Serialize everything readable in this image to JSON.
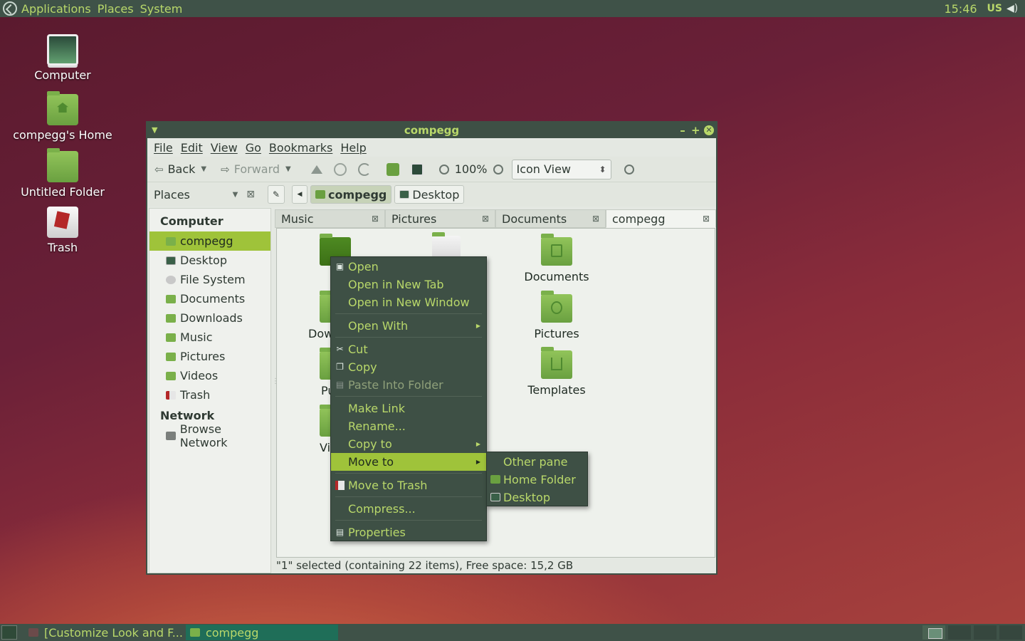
{
  "top_panel": {
    "menus": [
      "Applications",
      "Places",
      "System"
    ],
    "clock": "15:46",
    "keyboard": "US"
  },
  "desktop_icons": [
    {
      "label": "Computer",
      "icon": "computer-icon"
    },
    {
      "label": "compegg's Home",
      "icon": "home-folder-icon"
    },
    {
      "label": "Untitled Folder",
      "icon": "folder-icon"
    },
    {
      "label": "Trash",
      "icon": "trash-icon"
    }
  ],
  "window": {
    "title": "compegg",
    "menubar": [
      "File",
      "Edit",
      "View",
      "Go",
      "Bookmarks",
      "Help"
    ],
    "toolbar": {
      "back": "Back",
      "forward": "Forward",
      "zoom": "100%",
      "view_mode": "Icon View"
    },
    "location": {
      "places_label": "Places",
      "crumbs": [
        "compegg",
        "Desktop"
      ]
    },
    "sidebar": {
      "computer_header": "Computer",
      "items": [
        "compegg",
        "Desktop",
        "File System",
        "Documents",
        "Downloads",
        "Music",
        "Pictures",
        "Videos",
        "Trash"
      ],
      "network_header": "Network",
      "network_items": [
        "Browse Network"
      ]
    },
    "tabs": [
      "Music",
      "Pictures",
      "Documents",
      "compegg"
    ],
    "files": {
      "visible_partial": [
        "Dow",
        "Pu",
        "Vi"
      ],
      "items": [
        "Documents",
        "Pictures",
        "Templates"
      ]
    },
    "status": "\"1\" selected (containing 22 items), Free space: 15,2 GB"
  },
  "context_menu": {
    "items": [
      "Open",
      "Open in New Tab",
      "Open in New Window",
      "Open With",
      "Cut",
      "Copy",
      "Paste Into Folder",
      "Make Link",
      "Rename...",
      "Copy to",
      "Move to",
      "Move to Trash",
      "Compress...",
      "Properties"
    ],
    "highlighted": "Move to",
    "submenu": [
      "Other pane",
      "Home Folder",
      "Desktop"
    ]
  },
  "taskbar": {
    "tasks": [
      "[Customize Look and F...",
      "compegg"
    ]
  },
  "colors": {
    "accent": "#9fc33a",
    "panel": "#3f5248",
    "menu_text": "#b9d86a"
  }
}
